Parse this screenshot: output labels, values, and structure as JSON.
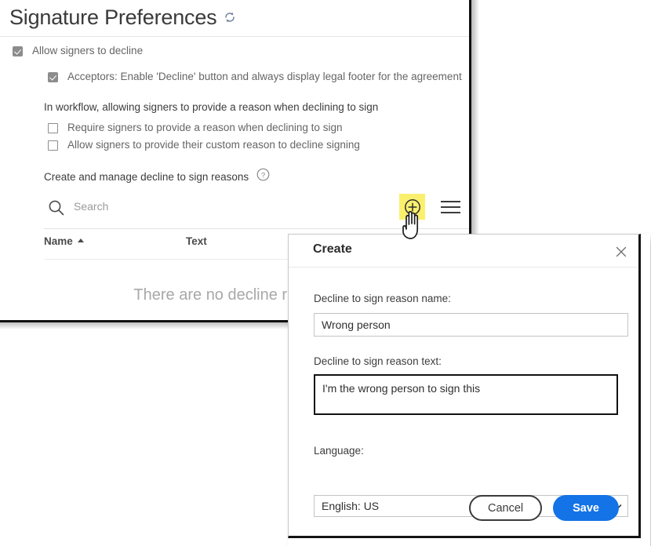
{
  "page": {
    "title": "Signature Preferences",
    "refresh_icon": "refresh-icon",
    "checkbox_allow_decline": {
      "label": "Allow signers to decline",
      "checked": true
    },
    "checkbox_acceptors": {
      "label": "Acceptors: Enable 'Decline' button and always display legal footer for the agreement",
      "checked": true
    },
    "workflow_heading": "In workflow, allowing signers to provide a reason when declining to sign",
    "checkbox_require_reason": {
      "label": "Require signers to provide a reason when declining to sign",
      "checked": false
    },
    "checkbox_custom_reason": {
      "label": "Allow signers to provide their custom reason to decline signing",
      "checked": false
    },
    "manage_label": "Create and manage decline to sign reasons",
    "help_icon": "help-circle-icon",
    "search": {
      "placeholder": "Search",
      "value": "",
      "icon": "search-icon"
    },
    "add_button_icon": "plus-circle-icon",
    "add_button_highlight_color": "#faf06e",
    "menu_button_icon": "hamburger-menu-icon",
    "table": {
      "columns": [
        "Name",
        "Text"
      ],
      "sort_column": "Name",
      "sort_direction": "ascending",
      "empty_message": "There are no decline reasons"
    }
  },
  "dialog": {
    "title": "Create",
    "close_icon": "close-icon",
    "name_label": "Decline to sign reason name:",
    "name_value": "Wrong person",
    "text_label": "Decline to sign reason text:",
    "text_value": "I'm the wrong person to sign this",
    "language_label": "Language:",
    "language_value": "English: US",
    "language_options": [
      "English: US"
    ],
    "cancel_label": "Cancel",
    "save_label": "Save",
    "save_color": "#1473e6"
  }
}
